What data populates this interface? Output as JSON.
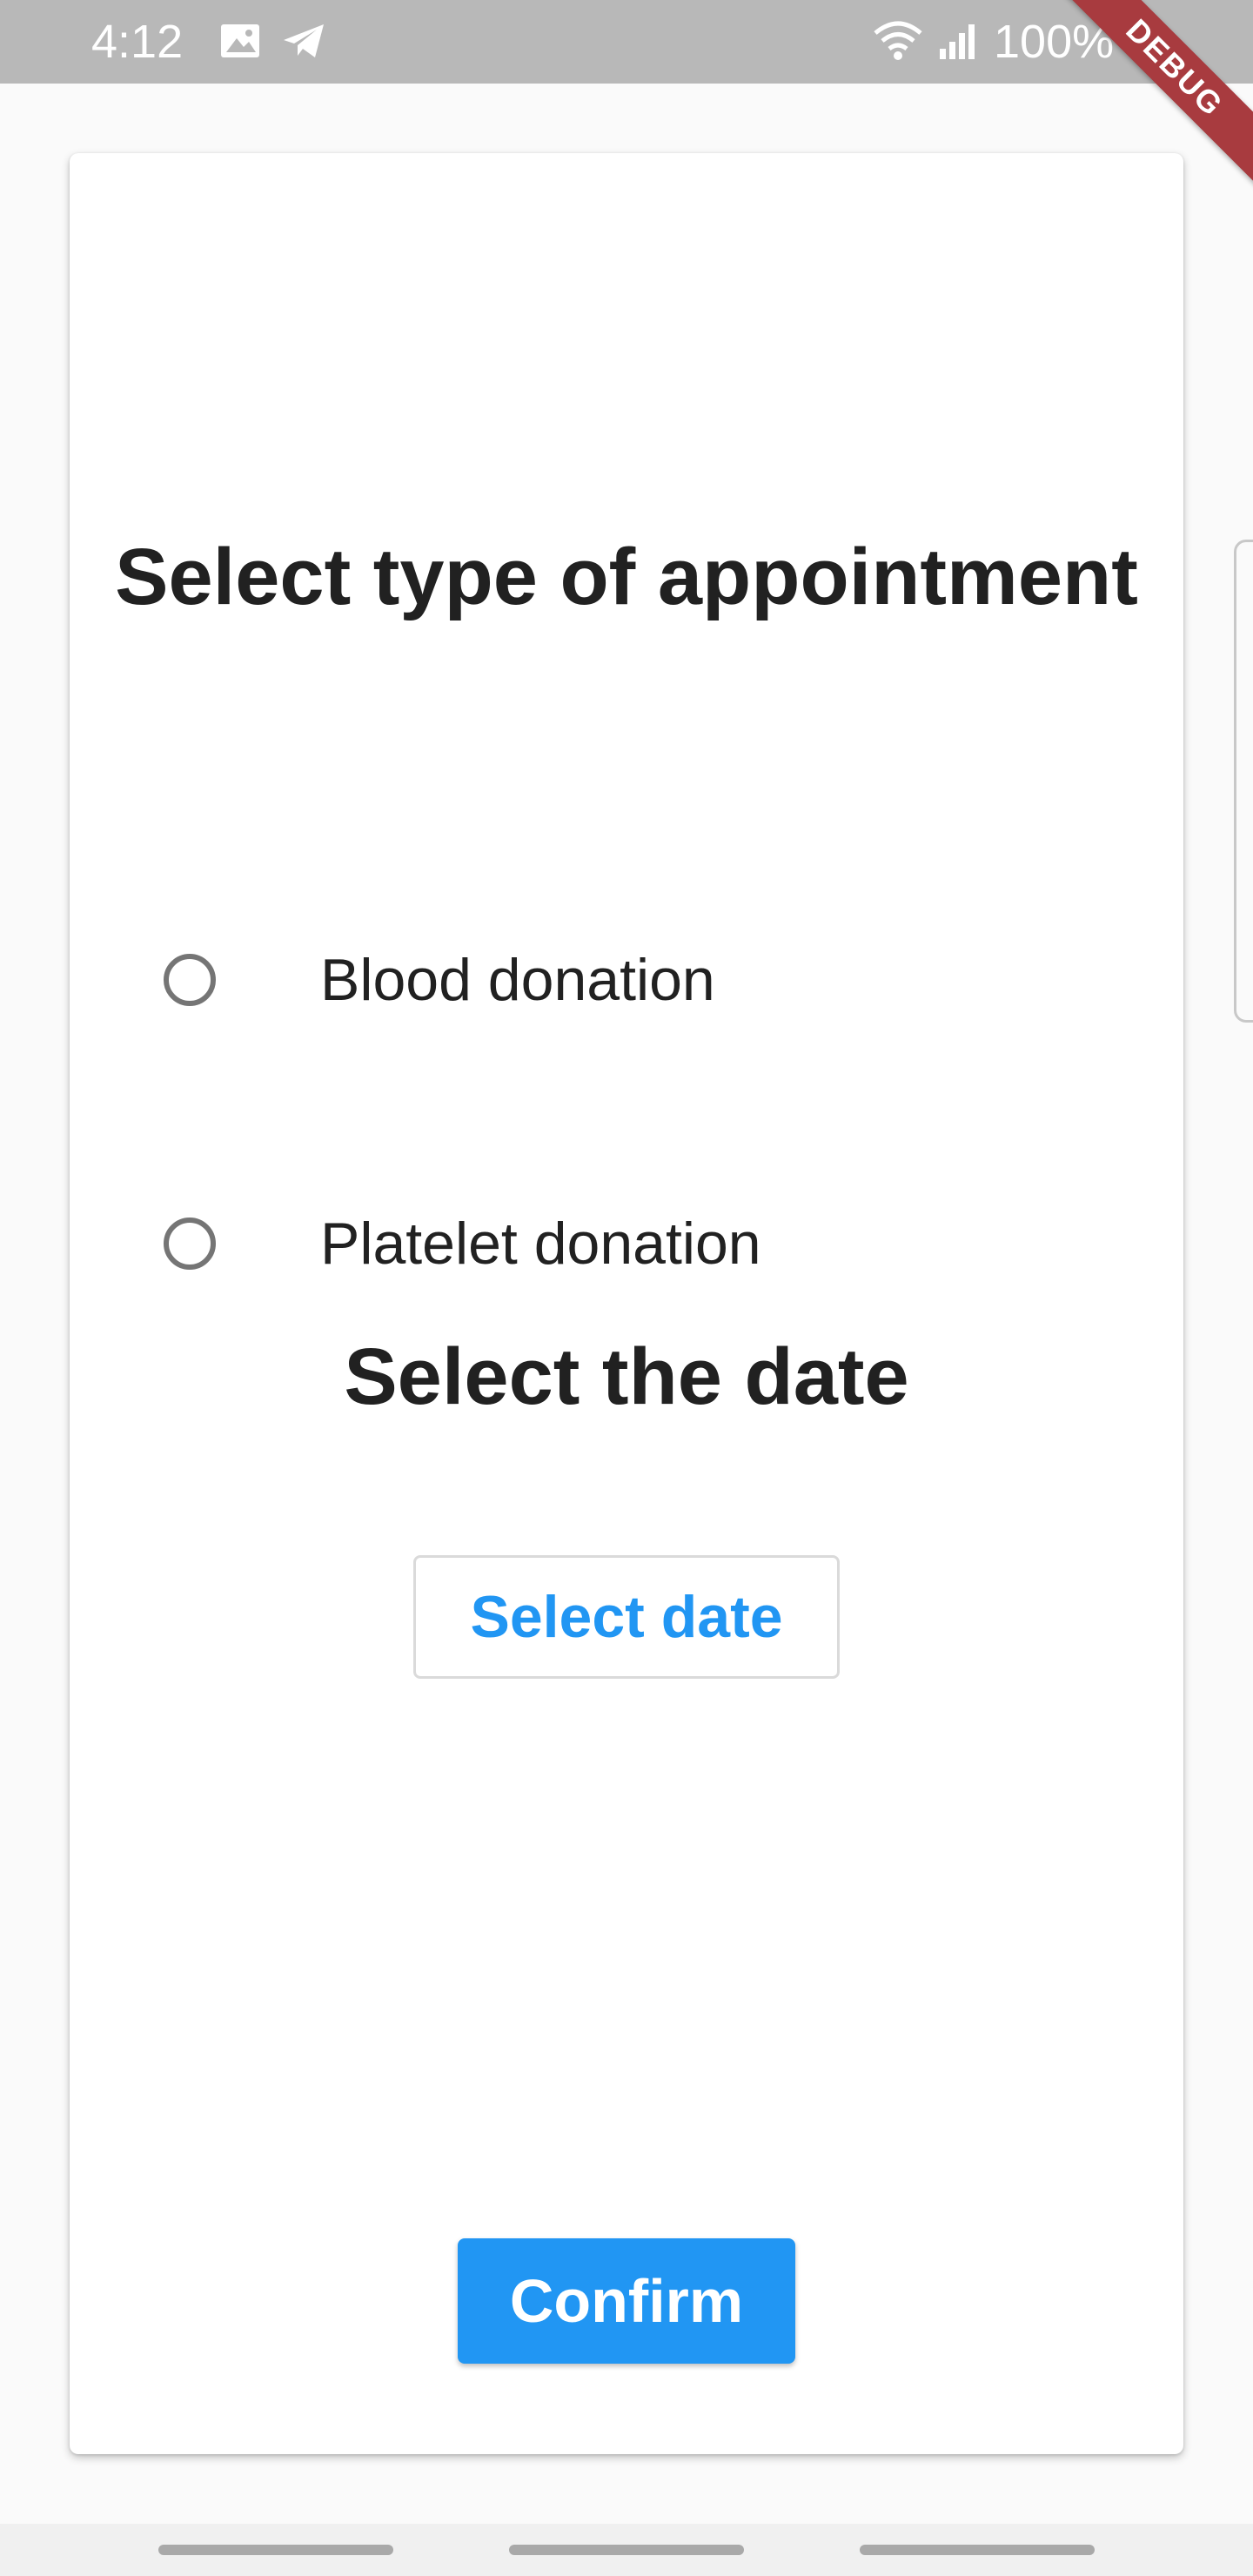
{
  "status_bar": {
    "time": "4:12",
    "battery": "100%",
    "icons": [
      "image-icon",
      "telegram-icon",
      "wifi-icon",
      "signal-icon",
      "battery-icon"
    ]
  },
  "debug_banner": "DEBUG",
  "appointment": {
    "title": "Select type of appointment",
    "options": [
      {
        "label": "Blood donation",
        "selected": false
      },
      {
        "label": "Platelet donation",
        "selected": false
      }
    ]
  },
  "date": {
    "title": "Select the date",
    "button_label": "Select date"
  },
  "confirm_label": "Confirm",
  "colors": {
    "accent": "#2196f3",
    "status_bar": "#b8b8b8",
    "debug_ribbon": "#a83b3f",
    "text": "#212121"
  }
}
